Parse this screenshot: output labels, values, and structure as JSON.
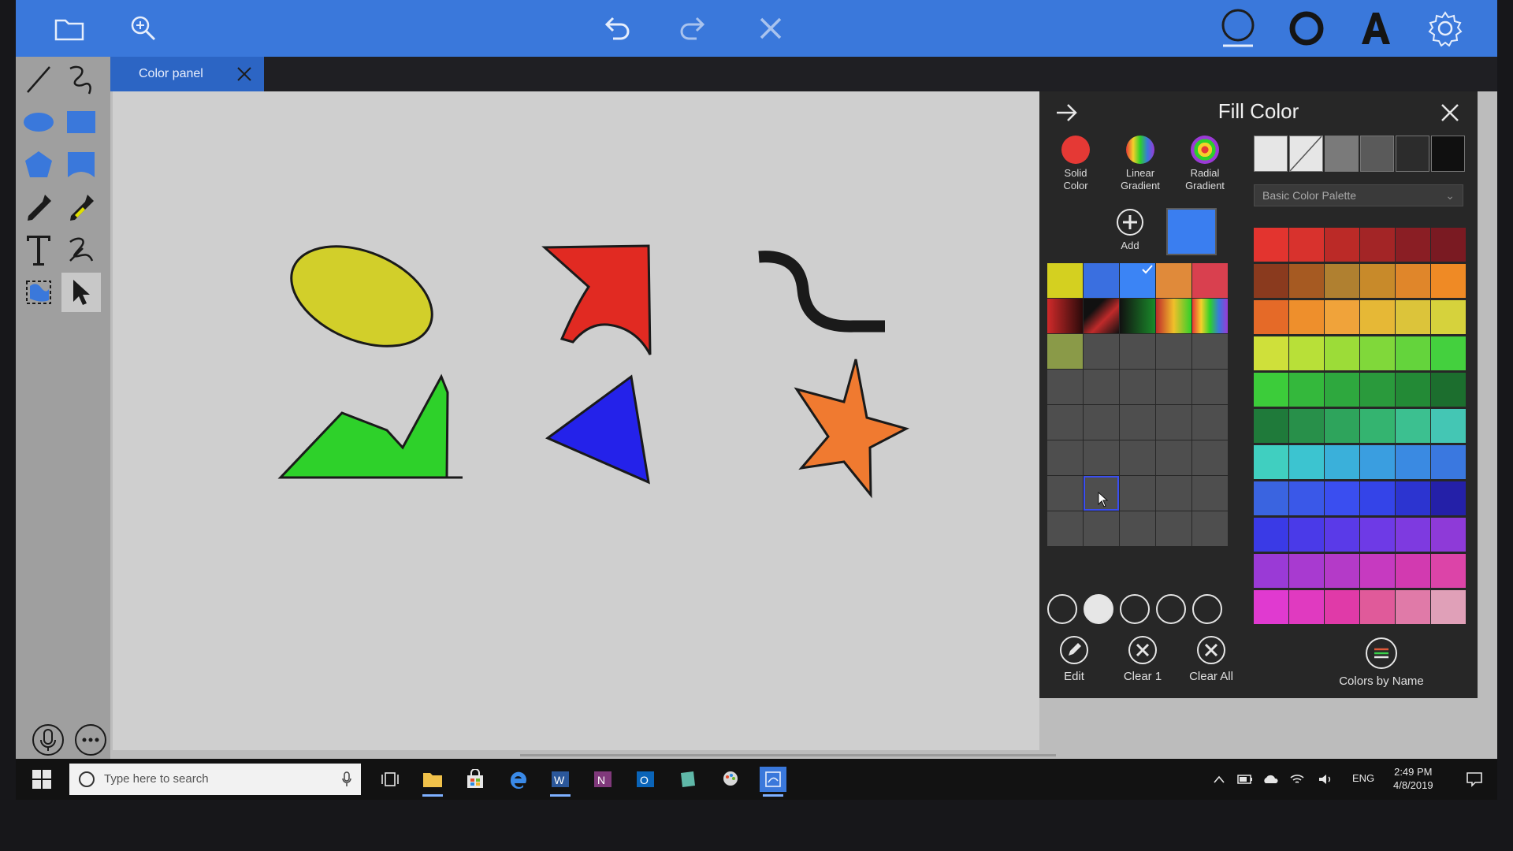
{
  "toolbar": {
    "items": [
      "open-folder",
      "zoom",
      "undo",
      "redo",
      "delete",
      "shape-outline",
      "stroke-width",
      "font",
      "settings"
    ]
  },
  "tabs": [
    {
      "label": "Color panel"
    }
  ],
  "fill_panel": {
    "title": "Fill Color",
    "modes": [
      {
        "label_line1": "Solid",
        "label_line2": "Color",
        "color": "#e53935"
      },
      {
        "label_line1": "Linear",
        "label_line2": "Gradient",
        "color": "rainbow"
      },
      {
        "label_line1": "Radial",
        "label_line2": "Gradient",
        "color": "radial"
      }
    ],
    "add_label": "Add",
    "current_color": "#3a7ef0",
    "palette_select": "Basic Color Palette",
    "buttons": {
      "edit": "Edit",
      "clear1": "Clear 1",
      "clear_all": "Clear All",
      "colors_by_name": "Colors by Name"
    },
    "custom_colors_row1": [
      "#d4d020",
      "#3a6fe0",
      "#3b84f5",
      "#e08a3a",
      "#d9404f"
    ],
    "custom_colors_row3": [
      "#8a9a48"
    ],
    "presets": [
      "#e6e6e6",
      "none",
      "#7a7a7a",
      "#5a5a5a",
      "#2c2c2c",
      "#101010"
    ],
    "basic_palette": [
      [
        "#e3342f",
        "#d8322d",
        "#bb2a27",
        "#a32526",
        "#8a1e24",
        "#7a1a22"
      ],
      [
        "#8a3a1e",
        "#a65a22",
        "#b08030",
        "#c88a2a",
        "#e0862a",
        "#ef8a25"
      ],
      [
        "#e56a28",
        "#ee8f2c",
        "#f0a33a",
        "#e6b836",
        "#dcc43a",
        "#d6d23c"
      ],
      [
        "#cfe03a",
        "#b8e038",
        "#9cdc38",
        "#80d83a",
        "#64d43c",
        "#44d03e"
      ],
      [
        "#3ccc3a",
        "#34b83c",
        "#2ea83e",
        "#2a9a3c",
        "#238a36",
        "#1c6e2e"
      ],
      [
        "#1f7a3a",
        "#28904a",
        "#2ea45c",
        "#34b470",
        "#3cc090",
        "#44c6b4"
      ],
      [
        "#40cfc0",
        "#3cc4d0",
        "#3ab0da",
        "#3a9ee0",
        "#3a8ae2",
        "#3a78e0"
      ],
      [
        "#3a64e0",
        "#3a58e8",
        "#3a4ef0",
        "#3444e8",
        "#2c34d0",
        "#2420a8"
      ],
      [
        "#3a3ae6",
        "#4a3ae8",
        "#5a3ae8",
        "#6e3ae6",
        "#7e3ae0",
        "#8e3ad8"
      ],
      [
        "#9a3ad6",
        "#a83ad0",
        "#b43ac8",
        "#c63ac0",
        "#d23ab0",
        "#dc44a8"
      ],
      [
        "#e03ad0",
        "#e03ac0",
        "#e03aa8",
        "#e05a9a",
        "#e07aa8",
        "#e0a0b8"
      ]
    ]
  },
  "taskbar": {
    "search_placeholder": "Type here to search",
    "language": "ENG",
    "time": "2:49 PM",
    "date": "4/8/2019"
  },
  "canvas_shapes": [
    {
      "name": "ellipse",
      "fill": "#d2cf2a"
    },
    {
      "name": "arrow-shape",
      "fill": "#e12a22"
    },
    {
      "name": "curve",
      "fill": "#1a1a1a"
    },
    {
      "name": "mountain-polygon",
      "fill": "#2ed12a"
    },
    {
      "name": "triangle",
      "fill": "#2422ea"
    },
    {
      "name": "star",
      "fill": "#f07a30"
    }
  ]
}
